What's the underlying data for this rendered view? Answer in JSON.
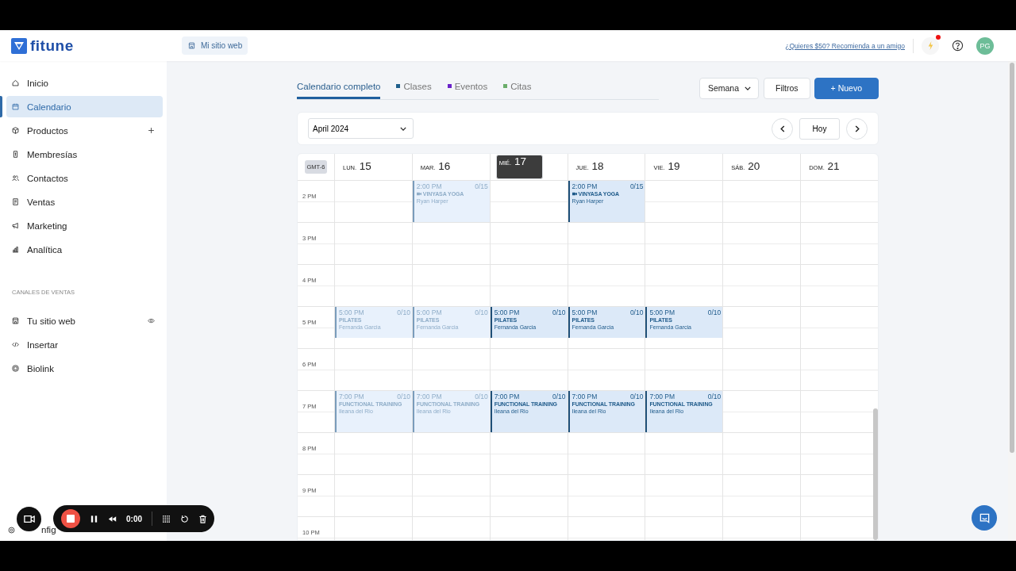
{
  "header": {
    "logo": "fitune",
    "site_button": "Mi sitio web",
    "referral_link": "¿Quieres $50? Recomienda a un amigo",
    "notification_dot": true,
    "avatar": "PG"
  },
  "sidebar": {
    "items": [
      {
        "label": "Inicio",
        "kind": "plain",
        "selected": false
      },
      {
        "label": "Calendario",
        "kind": "plain",
        "selected": true
      },
      {
        "label": "Productos",
        "kind": "addable",
        "selected": false
      },
      {
        "label": "Membresías",
        "kind": "plain",
        "selected": false
      },
      {
        "label": "Contactos",
        "kind": "plain",
        "selected": false
      },
      {
        "label": "Ventas",
        "kind": "plain",
        "selected": false
      },
      {
        "label": "Marketing",
        "kind": "plain",
        "selected": false
      },
      {
        "label": "Analítica",
        "kind": "plain",
        "selected": false
      }
    ],
    "section_title": "CANALES DE VENTAS",
    "channels": [
      {
        "label": "Tu sitio web",
        "kind": "viewable",
        "selected": false
      },
      {
        "label": "Insertar",
        "kind": "plain",
        "selected": false
      },
      {
        "label": "Biolink",
        "kind": "plain",
        "selected": false
      }
    ],
    "footer_item": "nfig"
  },
  "tabs": [
    {
      "label": "Calendario completo",
      "selected": true
    },
    {
      "label": "Clases",
      "selected": false,
      "color": "#1f5f8b"
    },
    {
      "label": "Eventos",
      "selected": false,
      "color": "#6a22c9"
    },
    {
      "label": "Citas",
      "selected": false,
      "color": "#6aad6a"
    }
  ],
  "view_select": "Semana",
  "filters_button": "Filtros",
  "new_button": "+ Nuevo",
  "month_select": "April 2024",
  "today_button": "Hoy",
  "calendar": {
    "timezone": "GMT-6",
    "days": [
      {
        "weekday": "LUN.",
        "date": "15",
        "today": false
      },
      {
        "weekday": "MAR.",
        "date": "16",
        "today": false
      },
      {
        "weekday": "MIÉ.",
        "date": "17",
        "today": true
      },
      {
        "weekday": "JUE.",
        "date": "18",
        "today": false
      },
      {
        "weekday": "VIE.",
        "date": "19",
        "today": false
      },
      {
        "weekday": "SÁB.",
        "date": "20",
        "today": false
      },
      {
        "weekday": "DOM.",
        "date": "21",
        "today": false
      }
    ],
    "hours": [
      {
        "label": "2 PM",
        "cells": [
          {
            "kind": "empty"
          },
          {
            "kind": "hour-event",
            "time": "2:00 PM",
            "capacity": "0/15",
            "title": "VINYASA YOGA",
            "instructor": "Ryan Harper",
            "video": true,
            "past": true
          },
          {
            "kind": "empty"
          },
          {
            "kind": "hour-event",
            "time": "2:00 PM",
            "capacity": "0/15",
            "title": "VINYASA YOGA",
            "instructor": "Ryan Harper",
            "video": true,
            "past": false
          },
          {
            "kind": "empty"
          },
          {
            "kind": "empty"
          },
          {
            "kind": "empty"
          }
        ]
      },
      {
        "label": "3 PM",
        "cells": [
          {
            "kind": "empty"
          },
          {
            "kind": "empty"
          },
          {
            "kind": "empty"
          },
          {
            "kind": "empty"
          },
          {
            "kind": "empty"
          },
          {
            "kind": "empty"
          },
          {
            "kind": "empty"
          }
        ]
      },
      {
        "label": "4 PM",
        "cells": [
          {
            "kind": "empty"
          },
          {
            "kind": "empty"
          },
          {
            "kind": "empty"
          },
          {
            "kind": "empty"
          },
          {
            "kind": "empty"
          },
          {
            "kind": "empty"
          },
          {
            "kind": "empty"
          }
        ]
      },
      {
        "label": "5 PM",
        "cells": [
          {
            "kind": "short-event",
            "time": "5:00 PM",
            "capacity": "0/10",
            "title": "PILATES",
            "instructor": "Fernanda Garcia",
            "video": false,
            "past": true
          },
          {
            "kind": "short-event",
            "time": "5:00 PM",
            "capacity": "0/10",
            "title": "PILATES",
            "instructor": "Fernanda Garcia",
            "video": false,
            "past": true
          },
          {
            "kind": "short-event",
            "time": "5:00 PM",
            "capacity": "0/10",
            "title": "PILATES",
            "instructor": "Fernanda Garcia",
            "video": false,
            "past": false
          },
          {
            "kind": "short-event",
            "time": "5:00 PM",
            "capacity": "0/10",
            "title": "PILATES",
            "instructor": "Fernanda Garcia",
            "video": false,
            "past": false
          },
          {
            "kind": "short-event",
            "time": "5:00 PM",
            "capacity": "0/10",
            "title": "PILATES",
            "instructor": "Fernanda Garcia",
            "video": false,
            "past": false
          },
          {
            "kind": "empty"
          },
          {
            "kind": "empty"
          }
        ]
      },
      {
        "label": "6 PM",
        "cells": [
          {
            "kind": "empty"
          },
          {
            "kind": "empty"
          },
          {
            "kind": "empty"
          },
          {
            "kind": "empty"
          },
          {
            "kind": "empty"
          },
          {
            "kind": "empty"
          },
          {
            "kind": "empty"
          }
        ]
      },
      {
        "label": "7 PM",
        "cells": [
          {
            "kind": "hour-event",
            "time": "7:00 PM",
            "capacity": "0/10",
            "title": "FUNCTIONAL TRAINING",
            "instructor": "Ileana del Rio",
            "video": false,
            "past": true
          },
          {
            "kind": "hour-event",
            "time": "7:00 PM",
            "capacity": "0/10",
            "title": "FUNCTIONAL TRAINING",
            "instructor": "Ileana del Rio",
            "video": false,
            "past": true
          },
          {
            "kind": "hour-event",
            "time": "7:00 PM",
            "capacity": "0/10",
            "title": "FUNCTIONAL TRAINING",
            "instructor": "Ileana del Rio",
            "video": false,
            "past": false
          },
          {
            "kind": "hour-event",
            "time": "7:00 PM",
            "capacity": "0/10",
            "title": "FUNCTIONAL TRAINING",
            "instructor": "Ileana del Rio",
            "video": false,
            "past": false
          },
          {
            "kind": "hour-event",
            "time": "7:00 PM",
            "capacity": "0/10",
            "title": "FUNCTIONAL TRAINING",
            "instructor": "Ileana del Rio",
            "video": false,
            "past": false
          },
          {
            "kind": "empty"
          },
          {
            "kind": "empty"
          }
        ]
      },
      {
        "label": "8 PM",
        "cells": [
          {
            "kind": "empty"
          },
          {
            "kind": "empty"
          },
          {
            "kind": "empty"
          },
          {
            "kind": "empty"
          },
          {
            "kind": "empty"
          },
          {
            "kind": "empty"
          },
          {
            "kind": "empty"
          }
        ]
      },
      {
        "label": "9 PM",
        "cells": [
          {
            "kind": "empty"
          },
          {
            "kind": "empty"
          },
          {
            "kind": "empty"
          },
          {
            "kind": "empty"
          },
          {
            "kind": "empty"
          },
          {
            "kind": "empty"
          },
          {
            "kind": "empty"
          }
        ]
      },
      {
        "label": "10 PM",
        "cells": [
          {
            "kind": "empty"
          },
          {
            "kind": "empty"
          },
          {
            "kind": "empty"
          },
          {
            "kind": "empty"
          },
          {
            "kind": "empty"
          },
          {
            "kind": "empty"
          },
          {
            "kind": "empty"
          }
        ]
      }
    ]
  },
  "recorder": {
    "timer": "0:00"
  }
}
